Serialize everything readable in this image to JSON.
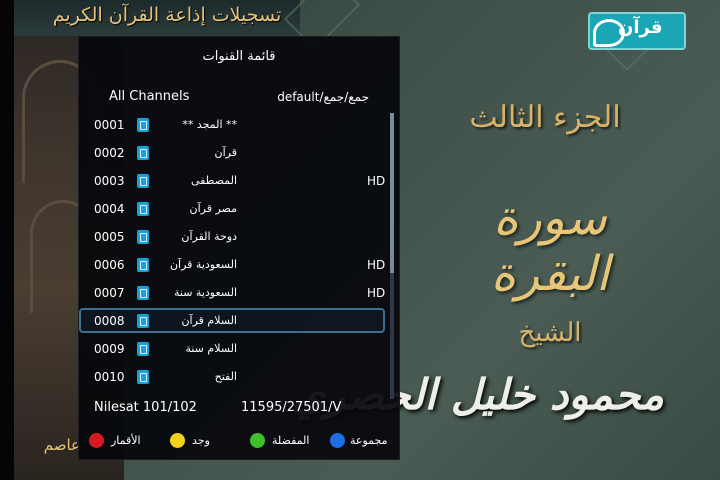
{
  "background": {
    "banner_title": "تسجيلات إذاعة القرآن الكريم",
    "juz_title": "الجزء الثالث",
    "surah_title": "سورة البقرة",
    "sheikh_label": "الشيخ",
    "reciter_name": "محمود خليل الحصري",
    "left_partial_name": "عاصم",
    "logo_text": "قرآن"
  },
  "channel_list": {
    "title": "قائمة القنوات",
    "group_name": "All Channels",
    "group_path": "default/جمع/جمع",
    "channels": [
      {
        "number": "0001",
        "name": "** المجد **",
        "hd": ""
      },
      {
        "number": "0002",
        "name": "قرآن",
        "hd": ""
      },
      {
        "number": "0003",
        "name": "المصطفى",
        "hd": "HD"
      },
      {
        "number": "0004",
        "name": "مصر قرآن",
        "hd": ""
      },
      {
        "number": "0005",
        "name": "دوحة القرآن",
        "hd": ""
      },
      {
        "number": "0006",
        "name": "السعودية قرآن",
        "hd": "HD"
      },
      {
        "number": "0007",
        "name": "السعودية سنة",
        "hd": "HD"
      },
      {
        "number": "0008",
        "name": "السلام قرآن",
        "hd": ""
      },
      {
        "number": "0009",
        "name": "السلام سنة",
        "hd": ""
      },
      {
        "number": "0010",
        "name": "الفتح",
        "hd": ""
      }
    ],
    "selected_number": "0008",
    "satellite": "Nilesat 101/102",
    "frequency": "11595/27501/V",
    "color_keys": [
      {
        "color": "#d81b22",
        "label": "الأقمار"
      },
      {
        "color": "#f2d21c",
        "label": "وجد"
      },
      {
        "color": "#3ec12b",
        "label": "المفضلة"
      },
      {
        "color": "#1e6ee6",
        "label": "مجموعة"
      }
    ]
  },
  "colors": {
    "panel_bg": "#06080c",
    "selection_border": "#3f6f8e",
    "channel_icon": "#18a2d6",
    "gold_text": "#d9b36a"
  }
}
